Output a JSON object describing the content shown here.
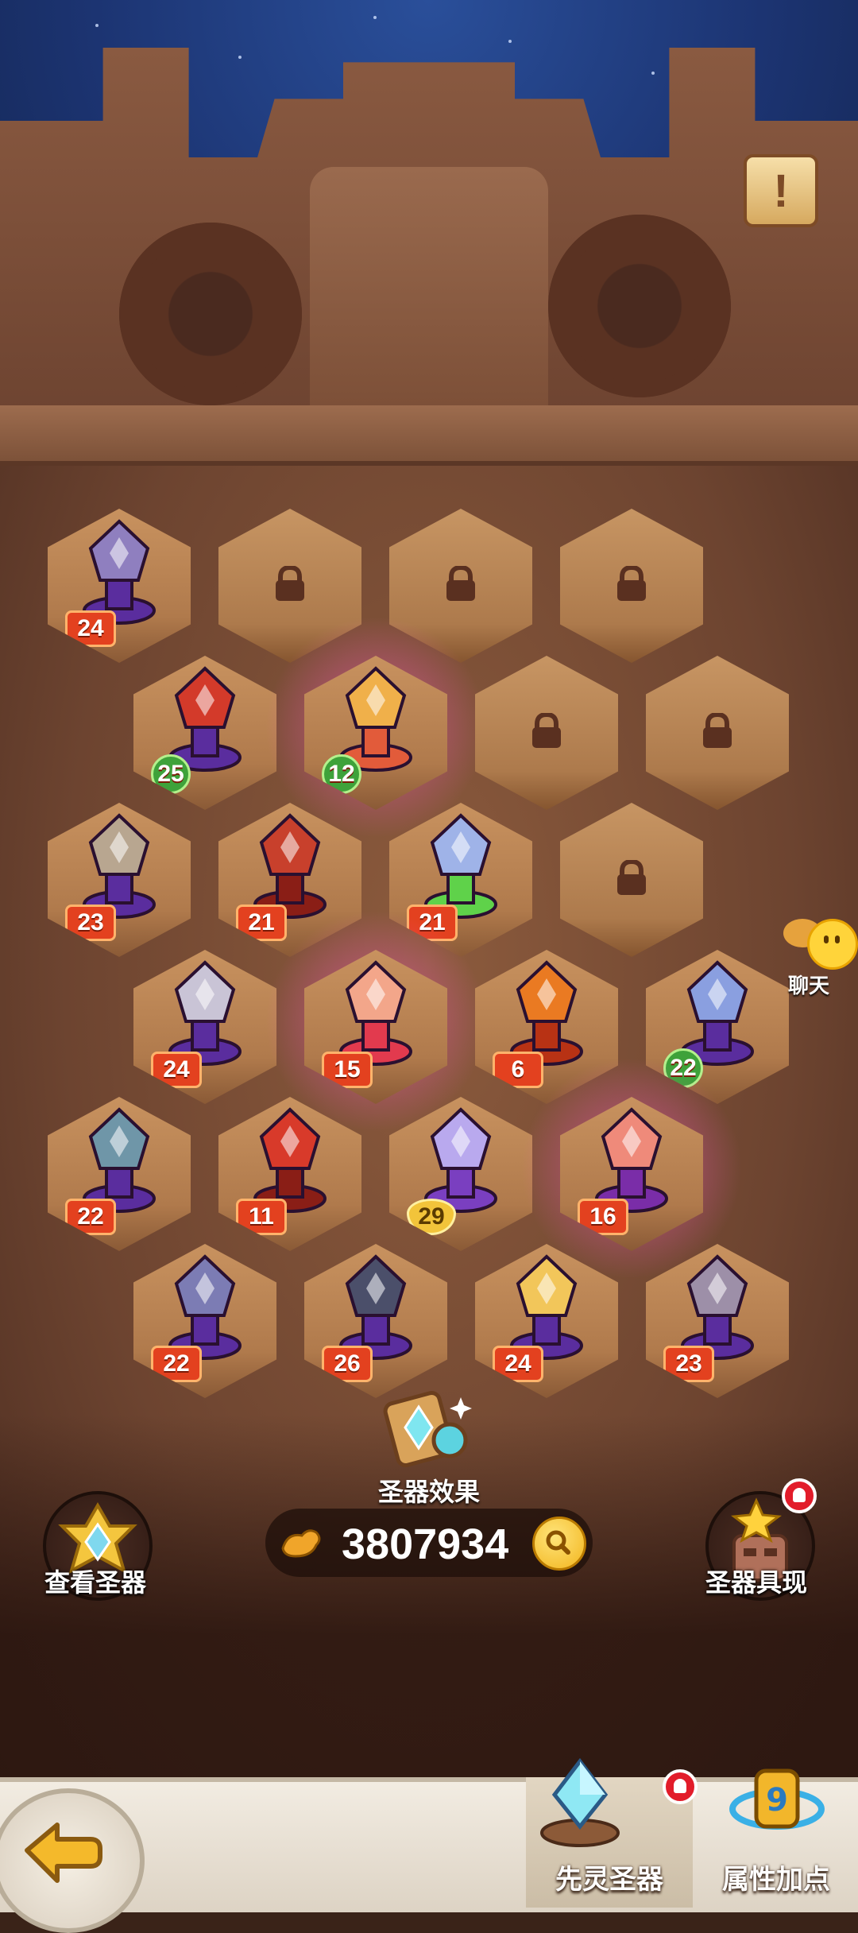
{
  "board": {
    "tiles": [
      {
        "level": "24",
        "style": "red",
        "kind": "purple-crown",
        "glow": false
      },
      {
        "level": "",
        "locked": true
      },
      {
        "level": "",
        "locked": true
      },
      {
        "level": "",
        "locked": true
      },
      {
        "level": "25",
        "style": "green",
        "kind": "red-horn",
        "glow": false
      },
      {
        "level": "12",
        "style": "green",
        "kind": "golden-mask",
        "glow": true
      },
      {
        "level": "",
        "locked": true
      },
      {
        "level": "",
        "locked": true
      },
      {
        "level": "23",
        "style": "red",
        "kind": "spiked-star",
        "glow": false
      },
      {
        "level": "21",
        "style": "red",
        "kind": "horned-demon",
        "glow": false
      },
      {
        "level": "21",
        "style": "red",
        "kind": "crystal-spirit",
        "glow": false
      },
      {
        "level": "",
        "locked": true
      },
      {
        "level": "24",
        "style": "red",
        "kind": "silver-fang",
        "glow": false
      },
      {
        "level": "15",
        "style": "red",
        "kind": "spiral-totem",
        "glow": true
      },
      {
        "level": "6",
        "style": "red",
        "kind": "orange-dragon",
        "glow": false
      },
      {
        "level": "22",
        "style": "green",
        "kind": "crystal-bust",
        "glow": false
      },
      {
        "level": "22",
        "style": "red",
        "kind": "stone-cross",
        "glow": false
      },
      {
        "level": "11",
        "style": "red",
        "kind": "red-beast",
        "glow": false
      },
      {
        "level": "29",
        "style": "gold",
        "kind": "ice-mage",
        "glow": false
      },
      {
        "level": "16",
        "style": "red",
        "kind": "flame-mask",
        "glow": true
      },
      {
        "level": "22",
        "style": "red",
        "kind": "crystal-star",
        "glow": false
      },
      {
        "level": "26",
        "style": "red",
        "kind": "dark-anvil",
        "glow": false
      },
      {
        "level": "24",
        "style": "red",
        "kind": "golden-wing",
        "glow": false
      },
      {
        "level": "23",
        "style": "red",
        "kind": "gear-tower",
        "glow": false
      }
    ]
  },
  "buttons": {
    "info": "!",
    "chat": "聊天",
    "view_artifacts": "查看圣器",
    "artifact_effect": "圣器效果",
    "manifest": "圣器具现"
  },
  "currency": {
    "amount": "3807934",
    "icon": "muscle-arm-icon"
  },
  "bottom_bar": {
    "tabs": [
      {
        "label": "先灵圣器",
        "active": true,
        "badge": true
      },
      {
        "label": "属性加点",
        "active": false,
        "badge": false
      }
    ]
  },
  "colors": {
    "level_badge": "#e3411f",
    "green_badge": "#3ea23a",
    "gold_badge": "#f2c43a",
    "notification": "#e21c2a"
  }
}
